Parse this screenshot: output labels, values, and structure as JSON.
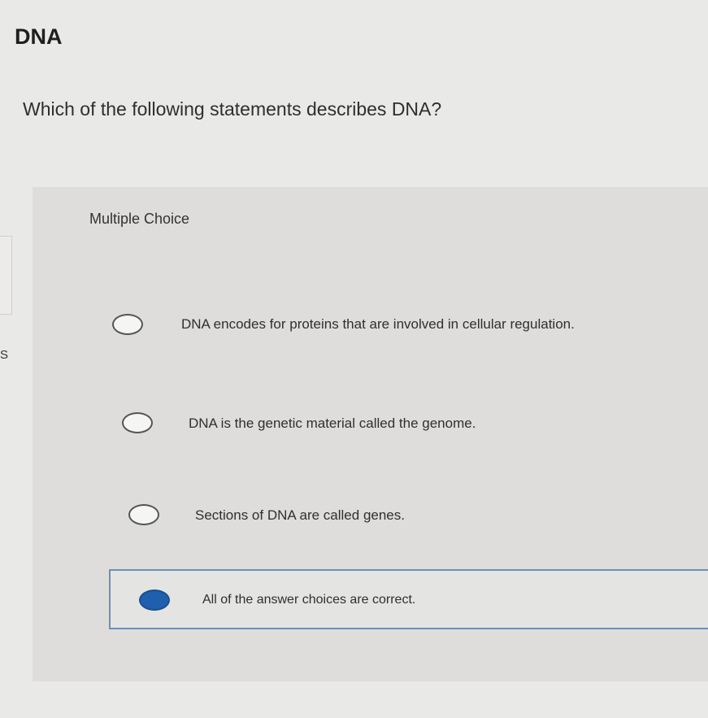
{
  "page": {
    "title": "DNA",
    "question": "Which of the following statements describes DNA?",
    "left_edge_letter": "S"
  },
  "question_block": {
    "type_label": "Multiple Choice",
    "options": [
      {
        "label": "DNA encodes for proteins that are involved in cellular regulation.",
        "selected": false
      },
      {
        "label": "DNA is the genetic material called the genome.",
        "selected": false
      },
      {
        "label": "Sections of DNA are called genes.",
        "selected": false
      },
      {
        "label": "All of the answer choices are correct.",
        "selected": true
      }
    ]
  },
  "colors": {
    "selected_radio": "#1f5fae",
    "selected_border": "#6d8fb3"
  }
}
